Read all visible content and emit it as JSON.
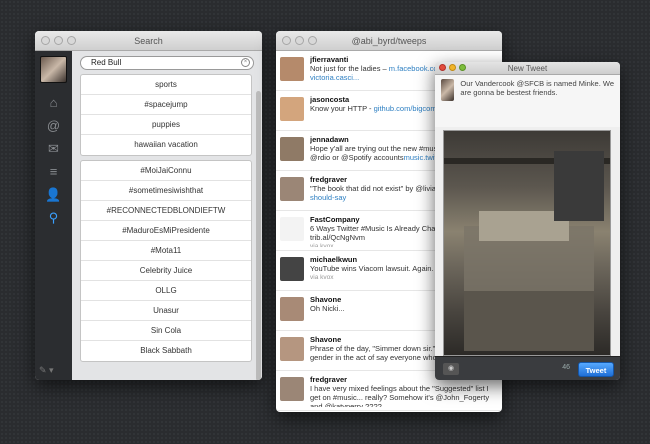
{
  "search_window": {
    "title": "Search",
    "query": "Red Bull",
    "group1": [
      "sports",
      "#spacejump",
      "puppies",
      "hawaiian vacation"
    ],
    "group2": [
      "#MoiJaiConnu",
      "#sometimesiwishthat",
      "#RECONNECTEDBLONDIEFTW",
      "#MaduroEsMiPresidente",
      "#Mota11",
      "Celebrity Juice",
      "OLLG",
      "Unasur",
      "Sin Cola",
      "Black Sabbath"
    ]
  },
  "timeline_window": {
    "title": "@abi_byrd/tweeps",
    "tweets": [
      {
        "name": "jfierravanti",
        "text": "Not just for the ladies – ",
        "link": "m.facebook.co",
        "extra": "victoria.casci..."
      },
      {
        "name": "jasoncosta",
        "text": "Know your HTTP - ",
        "link": "github.com/bigcom",
        "extra": ""
      },
      {
        "name": "jennadawn",
        "text": "Hope y'all are trying out the new #music those with @rdio or @Spotify accounts",
        "link": "music.twitter.com",
        "extra": ""
      },
      {
        "name": "fredgraver",
        "text": "\"The book that did not exist\" by @livia",
        "link": "medium.com/you-should-say",
        "extra": ""
      },
      {
        "name": "FastCompany",
        "text": "6 Ways Twitter #Music Is Already Chan Listen trib.al/QcNgNvm",
        "link": "",
        "extra": "via kvox"
      },
      {
        "name": "michaelkwun",
        "text": "YouTube wins Viacom lawsuit. Again.",
        "link": "",
        "extra": "via kvox"
      },
      {
        "name": "Shavone",
        "text": "Oh Nicki...",
        "link": "",
        "extra": ""
      },
      {
        "name": "Shavone",
        "text": "Phrase of the day, \"Simmer down sir.\" disregard your gender in the act of say everyone who seen lol)",
        "link": "",
        "extra": ""
      },
      {
        "name": "fredgraver",
        "text": "I have very mixed feelings about the \"Suggested\" list I get on #music... really? Somehow it's @John_Fogerty and @katyperry ????",
        "link": "",
        "extra": ""
      }
    ]
  },
  "new_tweet_window": {
    "title": "New Tweet",
    "text": "Our Vandercook @SFCB is named Minke. We are gonna be bestest friends.",
    "count": "46",
    "tweet_label": "Tweet"
  },
  "icons": [
    "home-icon",
    "mentions-icon",
    "messages-icon",
    "lists-icon",
    "profile-icon",
    "search-icon"
  ]
}
